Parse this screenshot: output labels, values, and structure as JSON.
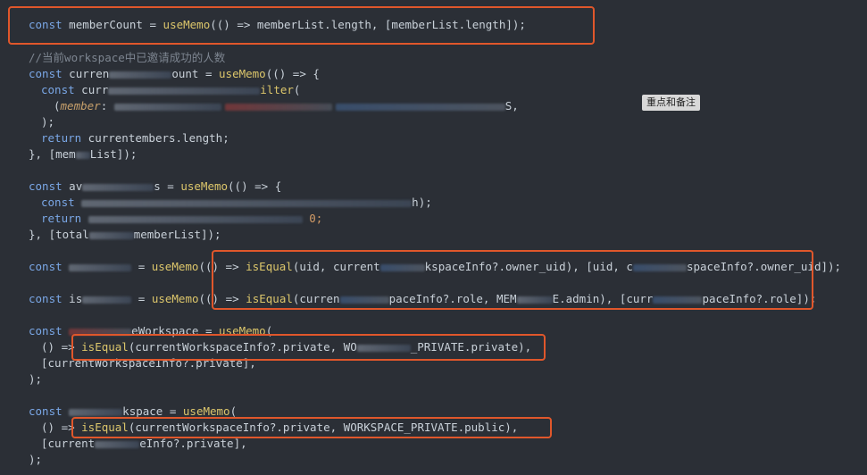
{
  "code": {
    "line1": {
      "kw": "const",
      "name": "memberCount",
      "op": " = ",
      "fn": "useMemo",
      "rest": "(() => memberList.length, [memberList.length]);"
    },
    "comment": "//当前workspace中已邀请成功的人数",
    "line3": {
      "kw": "const",
      "name_start": "curren",
      "name_end": "ount",
      "op": " = ",
      "fn": "useMemo",
      "rest": "(() => {"
    },
    "line4": {
      "kw": "const",
      "name_start": "curr",
      "fn": "ilter",
      "rest": "("
    },
    "line5": {
      "param": "member",
      "text": ": ",
      "end": "S,"
    },
    "line6": {
      "text": ");"
    },
    "line7": {
      "kw": "return",
      "text_start": " current",
      "text_end": "embers.length;"
    },
    "line8": {
      "text_start": "}, [mem",
      "text_end": "List]);"
    },
    "line10": {
      "kw": "const",
      "name_start": "av",
      "name_end": "s",
      "op": " = ",
      "fn": "useMemo",
      "rest": "(() => {"
    },
    "line11": {
      "kw": "const",
      "text_end": "h);"
    },
    "line12": {
      "kw": "return",
      "text_end": " 0;"
    },
    "line13": {
      "text_start": "}, [total",
      "text_end": "memberList]);"
    },
    "line15": {
      "kw": "const",
      "op": " = ",
      "fn": "useMemo",
      "arrow": "(() => ",
      "fn2": "isEqual",
      "rest_a": "(uid, current",
      "rest_b": "kspaceInfo?.owner_uid), [uid, c",
      "rest_c": "spaceInfo?.owner_uid]);"
    },
    "line17": {
      "kw": "const",
      "name_start": "is",
      "op": " = ",
      "fn": "useMemo",
      "arrow": "(() => ",
      "fn2": "isEqual",
      "rest_a": "(curren",
      "rest_b": "paceInfo?.role, MEM",
      "rest_c": "E.admin), [curr",
      "rest_d": "paceInfo?.role]);"
    },
    "line19": {
      "kw": "const",
      "name_end": "eWorkspace",
      "op": " = ",
      "fn": "useMemo",
      "rest": "("
    },
    "line20": {
      "arrow": "() => ",
      "fn2": "isEqual",
      "rest_a": "(currentWorkspaceInfo?.private, WO",
      "rest_b": "_PRIVATE.private),"
    },
    "line21": {
      "text": "[currentWorkspaceInfo?.private],"
    },
    "line22": {
      "text": ");"
    },
    "line24": {
      "kw": "const",
      "name_end": "kspace",
      "op": " = ",
      "fn": "useMemo",
      "rest": "("
    },
    "line25": {
      "arrow": "() => ",
      "fn2": "isEqual",
      "rest": "(currentWorkspaceInfo?.private, WORKSPACE_PRIVATE.public),"
    },
    "line26": {
      "text_start": "[current",
      "text_end": "eInfo?.private],"
    },
    "line27": {
      "text": ");"
    }
  },
  "tooltip": "重点和备注",
  "colors": {
    "highlight": "#e0572b",
    "background": "#2b2f36"
  }
}
